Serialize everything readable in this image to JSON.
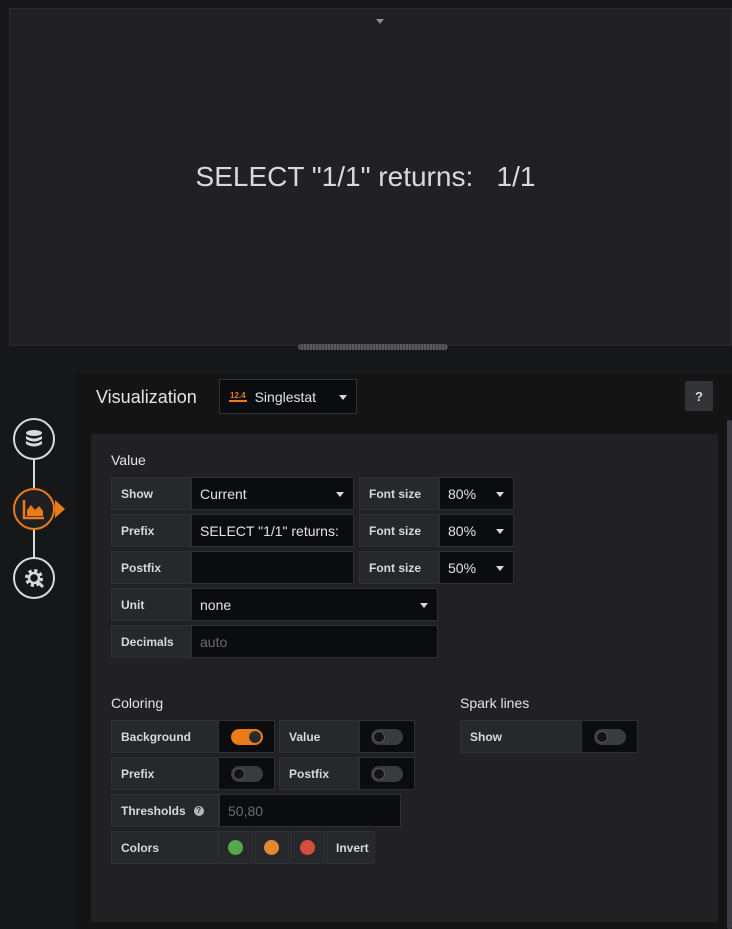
{
  "preview": {
    "stat_text": "SELECT \"1/1\" returns:   1/1"
  },
  "editor": {
    "title": "Visualization",
    "picker": {
      "icon_text": "12.4",
      "value": "Singlestat"
    },
    "help_label": "?"
  },
  "value_section": {
    "title": "Value",
    "show_label": "Show",
    "show_value": "Current",
    "prefix_label": "Prefix",
    "prefix_value": "SELECT \"1/1\" returns:",
    "postfix_label": "Postfix",
    "postfix_value": "",
    "font_size_label": "Font size",
    "font_sizes": [
      "80%",
      "80%",
      "50%"
    ],
    "unit_label": "Unit",
    "unit_value": "none",
    "decimals_label": "Decimals",
    "decimals_placeholder": "auto"
  },
  "coloring": {
    "title": "Coloring",
    "background_label": "Background",
    "background_on": true,
    "value_label": "Value",
    "value_on": false,
    "prefix_label": "Prefix",
    "prefix_on": false,
    "postfix_label": "Postfix",
    "postfix_on": false,
    "thresholds_label": "Thresholds",
    "thresholds_placeholder": "50,80",
    "colors_label": "Colors",
    "colors": [
      "#56a64b",
      "#e0892f",
      "#d44e3b"
    ],
    "invert_label": "Invert"
  },
  "spark_lines": {
    "title": "Spark lines",
    "show_label": "Show",
    "show_on": false
  },
  "theme": {
    "accent": "#eb7b18",
    "background": "#161719",
    "panel": "#212124"
  },
  "icons": [
    "database-icon",
    "chart-area-icon",
    "cog-icon",
    "chevron-down-icon",
    "question-circle-icon"
  ]
}
